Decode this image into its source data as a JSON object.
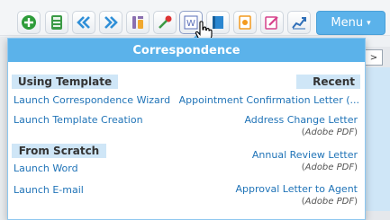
{
  "toolbar": {
    "buttons": [
      {
        "name": "add-icon",
        "color": "#2e9c3a"
      },
      {
        "name": "calculator-icon",
        "color": "#3a9a45"
      },
      {
        "name": "double-left-arrow-icon",
        "color": "#2f8fd8"
      },
      {
        "name": "double-right-arrow-icon",
        "color": "#2f8fd8"
      },
      {
        "name": "tools-icon",
        "color": "#8a6fb0"
      },
      {
        "name": "key-icon",
        "color": "#d33"
      },
      {
        "name": "word-document-icon",
        "color": "#5a6fb8"
      },
      {
        "name": "notebook-icon",
        "color": "#2a86d0"
      },
      {
        "name": "document-orange-icon",
        "color": "#f39a1e"
      },
      {
        "name": "edit-pink-icon",
        "color": "#d6408a"
      },
      {
        "name": "chart-trend-icon",
        "color": "#2f6fb8"
      }
    ],
    "menu_label": "Menu",
    "menu_caret": "▾"
  },
  "background": {
    "tab_glyph": ">"
  },
  "dropdown": {
    "title": "Correspondence",
    "using_template": {
      "header": "Using Template",
      "items": [
        "Launch Correspondence Wizard",
        "Launch Template Creation"
      ]
    },
    "from_scratch": {
      "header": "From Scratch",
      "items": [
        "Launch Word",
        "Launch E-mail"
      ]
    },
    "recent": {
      "header": "Recent",
      "items": [
        {
          "label": "Appointment Confirmation Letter (...",
          "format": ""
        },
        {
          "label": "Address Change Letter",
          "format_open": "(",
          "format": "Adobe PDF",
          "format_close": ")"
        },
        {
          "label": "Annual Review Letter",
          "format_open": "(",
          "format": "Adobe PDF",
          "format_close": ")"
        },
        {
          "label": "Approval Letter to Agent",
          "format_open": "(",
          "format": "Adobe PDF",
          "format_close": ")"
        }
      ]
    }
  },
  "colors": {
    "accent": "#5bb2ea",
    "section_bg": "#cfe6f7",
    "link": "#1f73b7"
  }
}
